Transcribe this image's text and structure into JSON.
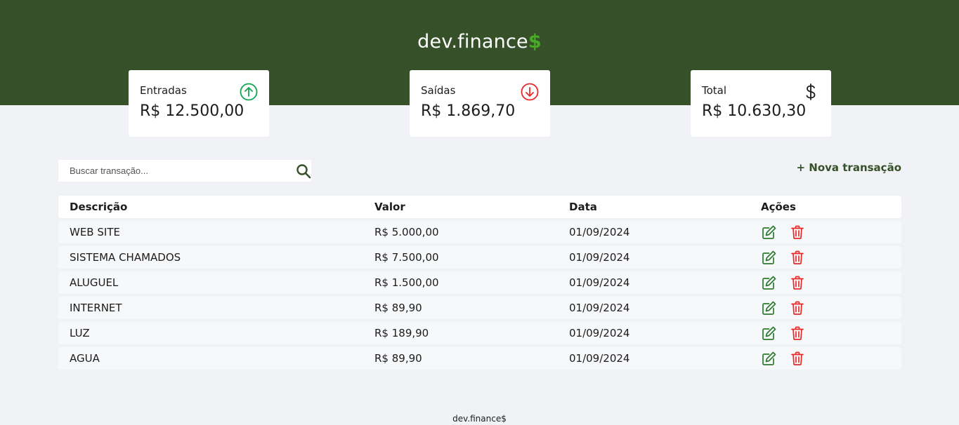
{
  "header": {
    "logo_main": "dev.finance",
    "logo_accent": "$"
  },
  "cards": {
    "income": {
      "label": "Entradas",
      "value": "R$ 12.500,00",
      "icon": "arrow-up-circle-icon",
      "color": "#12a454"
    },
    "expense": {
      "label": "Saídas",
      "value": "R$ 1.869,70",
      "icon": "arrow-down-circle-icon",
      "color": "#e92929"
    },
    "total": {
      "label": "Total",
      "value": "R$ 10.630,30",
      "icon": "dollar-icon",
      "color": "#1c1c1c"
    }
  },
  "search": {
    "placeholder": "Buscar transação...",
    "value": ""
  },
  "actions": {
    "new_transaction": "+ Nova transação"
  },
  "table": {
    "headers": [
      "Descrição",
      "Valor",
      "Data",
      "Ações"
    ],
    "rows": [
      {
        "description": "WEB SITE",
        "amount": "R$ 5.000,00",
        "date": "01/09/2024"
      },
      {
        "description": "SISTEMA CHAMADOS",
        "amount": "R$ 7.500,00",
        "date": "01/09/2024"
      },
      {
        "description": "ALUGUEL",
        "amount": "R$ 1.500,00",
        "date": "01/09/2024"
      },
      {
        "description": "INTERNET",
        "amount": "R$ 89,90",
        "date": "01/09/2024"
      },
      {
        "description": "LUZ",
        "amount": "R$ 189,90",
        "date": "01/09/2024"
      },
      {
        "description": "AGUA",
        "amount": "R$ 89,90",
        "date": "01/09/2024"
      }
    ]
  },
  "footer": {
    "text": "dev.finance$"
  },
  "colors": {
    "brand": "#36512a",
    "accent": "#49aa26",
    "edit": "#2d7a2d",
    "delete": "#e92929"
  }
}
